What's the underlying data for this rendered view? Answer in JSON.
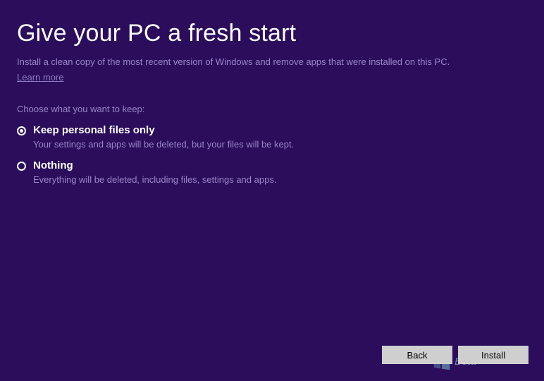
{
  "header": {
    "title": "Give your PC a fresh start",
    "subtitle": "Install a clean copy of the most recent version of Windows and remove apps that were installed on this PC.",
    "learn_more": "Learn more"
  },
  "section_label": "Choose what you want to keep:",
  "options": [
    {
      "label": "Keep personal files only",
      "description": "Your settings and apps will be deleted, but your files will be kept.",
      "selected": true
    },
    {
      "label": "Nothing",
      "description": "Everything will be deleted, including files, settings and apps.",
      "selected": false
    }
  ],
  "buttons": {
    "back": "Back",
    "install": "Install"
  },
  "watermark": {
    "text": "Beta"
  }
}
